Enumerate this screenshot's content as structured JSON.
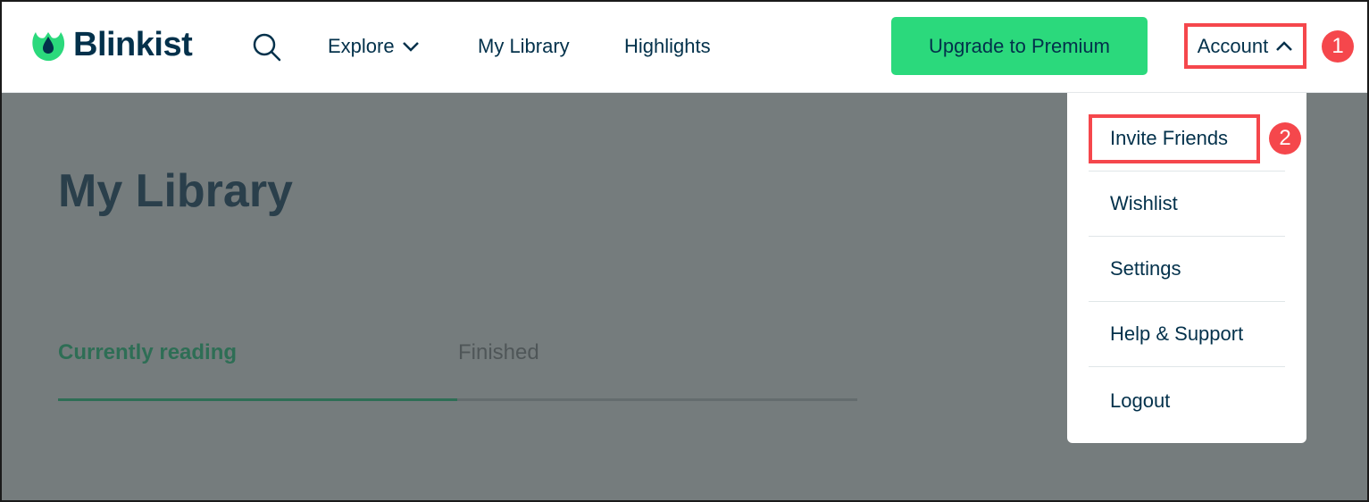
{
  "brand": {
    "name": "Blinkist",
    "logo_icon": "blinkist-leaf-drop-logo",
    "colors": {
      "primary_dark": "#03314b",
      "accent_green": "#2bd97c",
      "annotation_red": "#f5474c",
      "overlay": "#757c7d"
    }
  },
  "header": {
    "search_icon": "search-icon",
    "nav": [
      {
        "label": "Explore",
        "icon": "chevron-down-icon"
      },
      {
        "label": "My Library"
      },
      {
        "label": "Highlights"
      }
    ],
    "upgrade_label": "Upgrade to Premium",
    "account_label": "Account",
    "account_icon": "chevron-up-icon"
  },
  "annotations": {
    "step1": "1",
    "step2": "2"
  },
  "main": {
    "title": "My Library",
    "tabs": [
      {
        "label": "Currently reading",
        "active": true
      },
      {
        "label": "Finished",
        "active": false
      }
    ]
  },
  "account_menu": {
    "items": [
      {
        "label": "Invite Friends"
      },
      {
        "label": "Wishlist"
      },
      {
        "label": "Settings"
      },
      {
        "label": "Help & Support"
      },
      {
        "label": "Logout"
      }
    ]
  }
}
